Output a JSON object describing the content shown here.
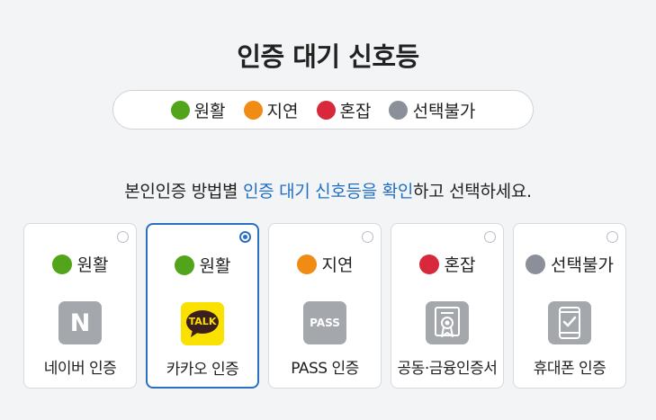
{
  "title": "인증 대기 신호등",
  "legend": [
    {
      "label": "원활",
      "color": "#52a41a"
    },
    {
      "label": "지연",
      "color": "#f08c14"
    },
    {
      "label": "혼잡",
      "color": "#d8283c"
    },
    {
      "label": "선택불가",
      "color": "#8a8f99"
    }
  ],
  "instruction": {
    "before": "본인인증 방법별 ",
    "highlight": "인증 대기 신호등을 확인",
    "after": "하고 선택하세요."
  },
  "cards": [
    {
      "status": "원활",
      "status_color": "#52a41a",
      "label": "네이버 인증",
      "icon": "naver-logo-icon",
      "selected": false
    },
    {
      "status": "원활",
      "status_color": "#52a41a",
      "label": "카카오 인증",
      "icon": "kakao-talk-icon",
      "selected": true
    },
    {
      "status": "지연",
      "status_color": "#f08c14",
      "label": "PASS 인증",
      "icon": "pass-logo-icon",
      "selected": false
    },
    {
      "status": "혼잡",
      "status_color": "#d8283c",
      "label": "공동·금융인증서",
      "icon": "certificate-icon",
      "selected": false
    },
    {
      "status": "선택불가",
      "status_color": "#8a8f99",
      "label": "휴대폰 인증",
      "icon": "mobile-phone-check-icon",
      "selected": false
    }
  ],
  "icon_text": {
    "naver": "N",
    "kakao": "TALK",
    "pass": "PASS"
  }
}
